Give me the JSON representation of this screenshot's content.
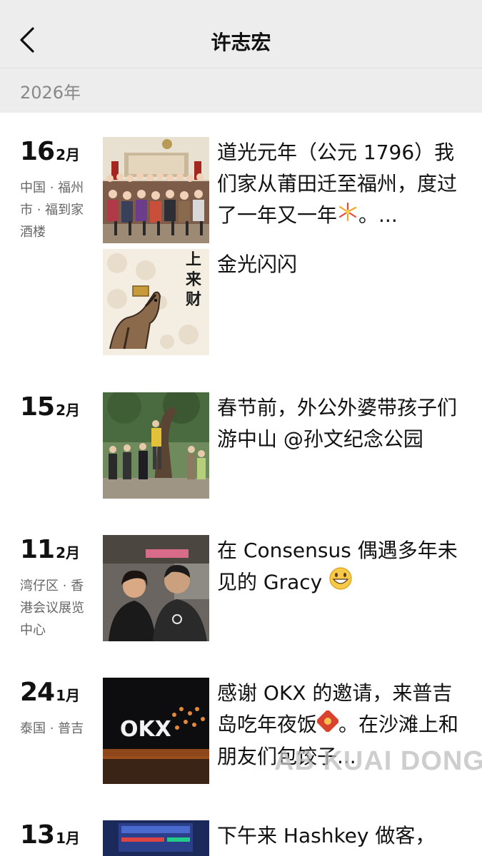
{
  "nav": {
    "title": "许志宏",
    "back_icon": "chevron-left-icon"
  },
  "year": "2026年",
  "posts": [
    {
      "day": "16",
      "month": "2月",
      "location": "中国 · 福州市 · 福到家酒楼",
      "entries": [
        {
          "text": "道光元年（公元 1796）我们家从莆田迁至福州，度过了一年又一年",
          "suffix": "。...",
          "image": "family-group-photo"
        },
        {
          "text": "金光闪闪",
          "image": "horse-fortune-painting"
        }
      ]
    },
    {
      "day": "15",
      "month": "2月",
      "location": "",
      "text": "春节前，外公外婆带孩子们游中山 @孙文纪念公园",
      "image": "park-tree-group-photo"
    },
    {
      "day": "11",
      "month": "2月",
      "location": "湾仔区 · 香港会议展览中心",
      "text": "在 Consensus 偶遇多年未见的 Gracy",
      "image": "two-people-photo"
    },
    {
      "day": "24",
      "month": "1月",
      "location": "泰国 · 普吉",
      "text": "感谢 OKX 的邀请，来普吉岛吃年夜饭",
      "suffix": "。在沙滩上和朋友们包饺子...",
      "image": "okx-beach-night-photo"
    },
    {
      "day": "13",
      "month": "1月",
      "location": "",
      "text": "下午来 Hashkey 做客，",
      "image": "stock-ticker-screen-photo"
    }
  ],
  "painting_text": "马上来财",
  "okx_logo_text": "OKX",
  "watermark": "AB KUAI DONG",
  "colors": {
    "nav_bg": "#ededed",
    "year_text": "#888888",
    "location_text": "#666666"
  }
}
